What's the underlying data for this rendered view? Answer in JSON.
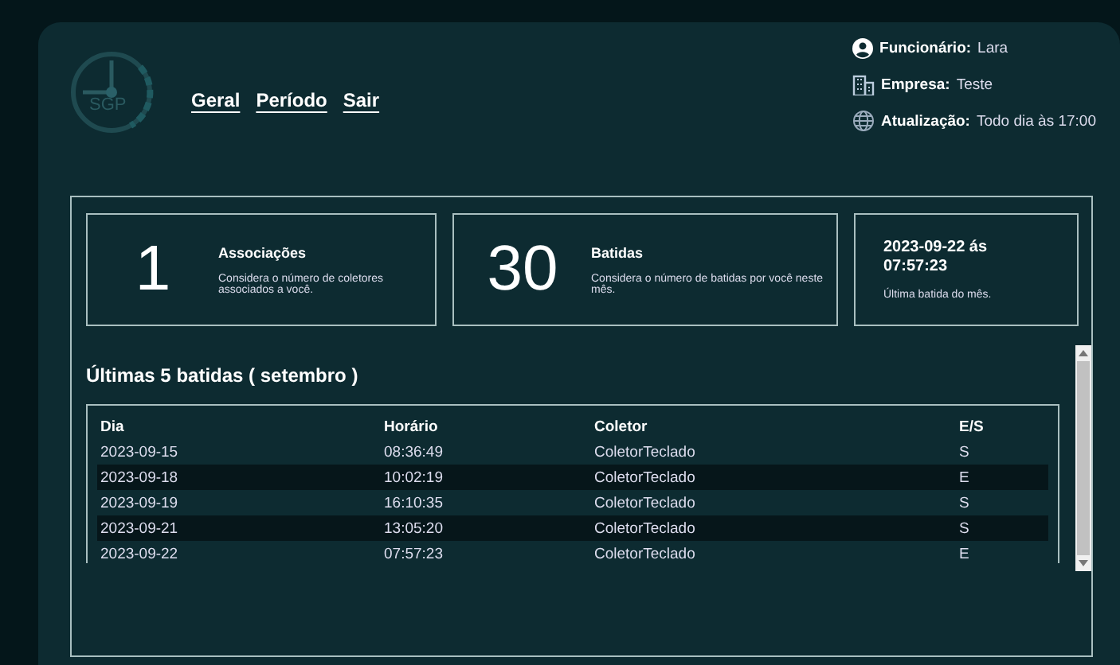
{
  "logo": {
    "text": "SGP"
  },
  "nav": [
    {
      "label": "Geral"
    },
    {
      "label": "Período"
    },
    {
      "label": "Sair"
    }
  ],
  "info": [
    {
      "kind": "user",
      "label": "Funcionário:",
      "value": "Lara"
    },
    {
      "kind": "building",
      "label": "Empresa:",
      "value": "Teste"
    },
    {
      "kind": "globe",
      "label": "Atualização:",
      "value": "Todo dia às 17:00"
    }
  ],
  "stats": [
    {
      "kind": "big",
      "number": "1",
      "title": "Associações",
      "description": "Considera o número de coletores associados a você."
    },
    {
      "kind": "big",
      "number": "30",
      "title": "Batidas",
      "description": "Considera o número de batidas por você neste mês."
    },
    {
      "kind": "date",
      "title": "2023-09-22 ás 07:57:23",
      "description": "Última batida do mês."
    }
  ],
  "recent": {
    "title": "Últimas 5 batidas ( setembro )",
    "columns": [
      "Dia",
      "Horário",
      "Coletor",
      "E/S"
    ],
    "rows": [
      [
        "2023-09-15",
        "08:36:49",
        "ColetorTeclado",
        "S"
      ],
      [
        "2023-09-18",
        "10:02:19",
        "ColetorTeclado",
        "E"
      ],
      [
        "2023-09-19",
        "16:10:35",
        "ColetorTeclado",
        "S"
      ],
      [
        "2023-09-21",
        "13:05:20",
        "ColetorTeclado",
        "S"
      ],
      [
        "2023-09-22",
        "07:57:23",
        "ColetorTeclado",
        "E"
      ]
    ]
  }
}
